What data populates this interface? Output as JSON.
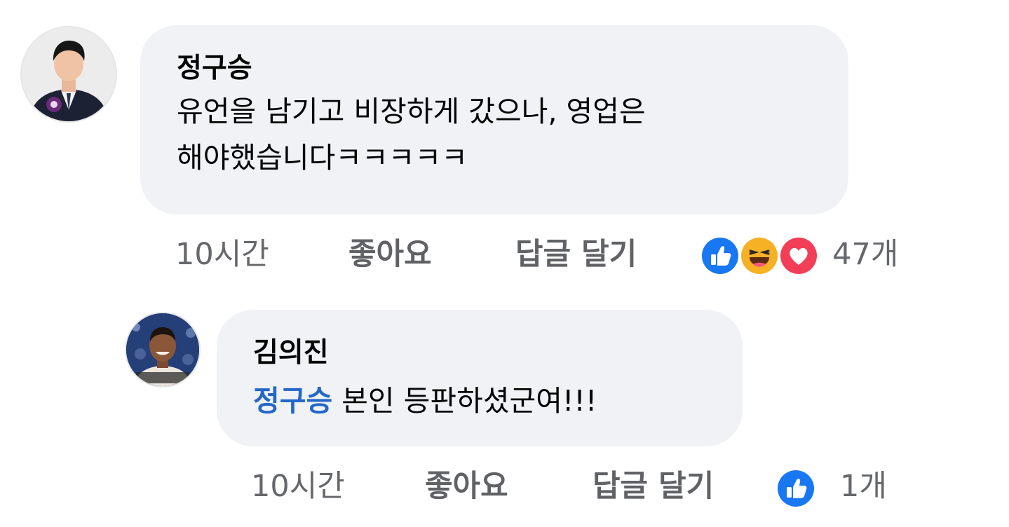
{
  "comments": [
    {
      "author": "정구승",
      "text_line1": "유언을 남기고 비장하게 갔으나, 영업은",
      "text_line2": "해야했습니다ㅋㅋㅋㅋㅋ",
      "time": "10시간",
      "like_label": "좋아요",
      "reply_label": "답글 달기",
      "reactions": [
        "like-icon",
        "haha-icon",
        "love-icon"
      ],
      "reaction_count": "47개"
    },
    {
      "author": "김의진",
      "mention": "정구승",
      "text": " 본인 등판하셨군여!!!",
      "time": "10시간",
      "like_label": "좋아요",
      "reply_label": "답글 달기",
      "reactions": [
        "like-icon"
      ],
      "reaction_count": "1개"
    }
  ],
  "colors": {
    "bubble": "#f0f2f5",
    "mention": "#2467c9",
    "like": "#1877f2",
    "haha": "#f7b125",
    "love": "#f33e58",
    "meta": "#65676b"
  }
}
